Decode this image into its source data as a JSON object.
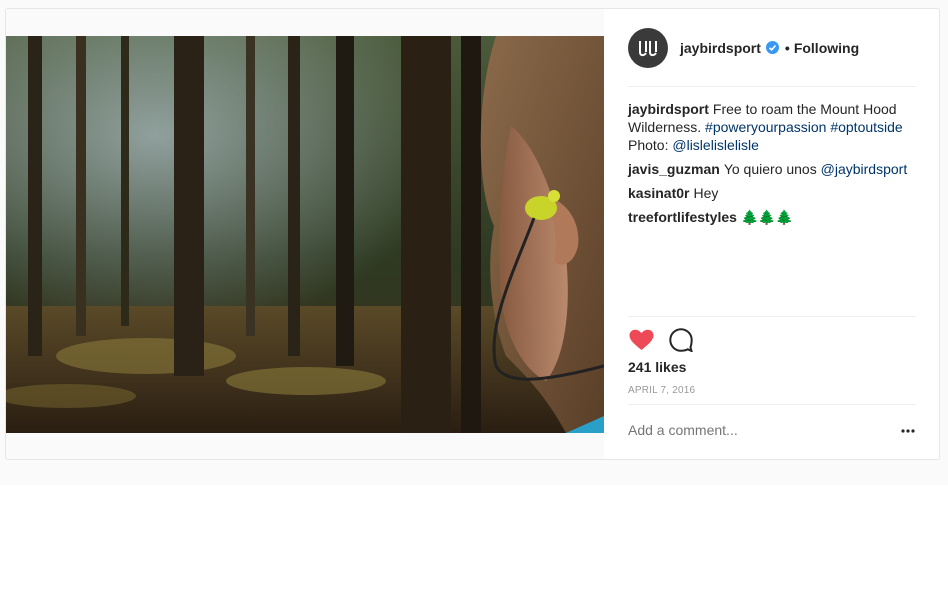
{
  "post": {
    "username": "jaybirdsport",
    "following_label": "Following",
    "dot": "•",
    "caption": {
      "user": "jaybirdsport",
      "text": "Free to roam the Mount Hood Wilderness. ",
      "tag1": "#poweryourpassion",
      "tag2": "#optoutside",
      "photo_label": " Photo: ",
      "mention": "@lislelislelisle"
    },
    "comments": [
      {
        "user": "javis_guzman",
        "text": "Yo quiero unos ",
        "mention": "@jaybirdsport"
      },
      {
        "user": "kasinat0r",
        "text": "Hey"
      },
      {
        "user": "treefortlifestyles",
        "text": "🌲🌲🌲"
      }
    ],
    "likes": "241 likes",
    "date": "APRIL 7, 2016",
    "add_comment_placeholder": "Add a comment...",
    "more_label": "•••"
  },
  "colors": {
    "heart": "#ed4956",
    "verified": "#3897f0",
    "link": "#003569",
    "muted": "#999999"
  },
  "icons": {
    "avatar": "jaybird-logo-icon",
    "verified": "verified-badge-icon",
    "like": "heart-icon",
    "comment": "comment-bubble-icon",
    "more": "more-options-icon"
  }
}
